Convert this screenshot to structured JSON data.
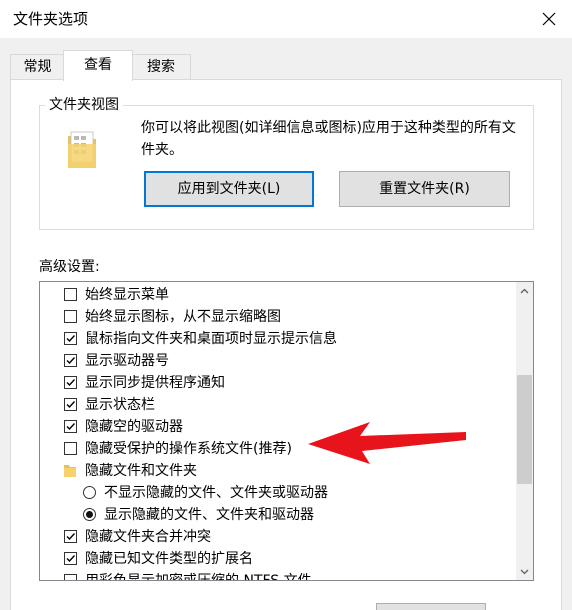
{
  "window": {
    "title": "文件夹选项"
  },
  "tabs": [
    {
      "label": "常规",
      "active": false
    },
    {
      "label": "查看",
      "active": true
    },
    {
      "label": "搜索",
      "active": false
    }
  ],
  "folder_view": {
    "legend": "文件夹视图",
    "description": "你可以将此视图(如详细信息或图标)应用于这种类型的所有文件夹。",
    "apply_button": "应用到文件夹(L)",
    "reset_button": "重置文件夹(R)"
  },
  "advanced": {
    "label": "高级设置:",
    "items": [
      {
        "type": "checkbox",
        "checked": false,
        "label": "始终显示菜单"
      },
      {
        "type": "checkbox",
        "checked": false,
        "label": "始终显示图标，从不显示缩略图"
      },
      {
        "type": "checkbox",
        "checked": true,
        "label": "鼠标指向文件夹和桌面项时显示提示信息"
      },
      {
        "type": "checkbox",
        "checked": true,
        "label": "显示驱动器号"
      },
      {
        "type": "checkbox",
        "checked": true,
        "label": "显示同步提供程序通知"
      },
      {
        "type": "checkbox",
        "checked": true,
        "label": "显示状态栏"
      },
      {
        "type": "checkbox",
        "checked": true,
        "label": "隐藏空的驱动器"
      },
      {
        "type": "checkbox",
        "checked": false,
        "label": "隐藏受保护的操作系统文件(推荐)"
      },
      {
        "type": "folder",
        "label": "隐藏文件和文件夹"
      },
      {
        "type": "radio",
        "checked": false,
        "label": "不显示隐藏的文件、文件夹或驱动器"
      },
      {
        "type": "radio",
        "checked": true,
        "label": "显示隐藏的文件、文件夹和驱动器"
      },
      {
        "type": "checkbox",
        "checked": true,
        "label": "隐藏文件夹合并冲突"
      },
      {
        "type": "checkbox",
        "checked": true,
        "label": "隐藏已知文件类型的扩展名"
      },
      {
        "type": "checkbox",
        "checked": false,
        "label": "用彩色显示加密或压缩的 NTFS 文件"
      }
    ]
  },
  "colors": {
    "accent": "#0078d7",
    "annotation_arrow": "#e8141c"
  }
}
